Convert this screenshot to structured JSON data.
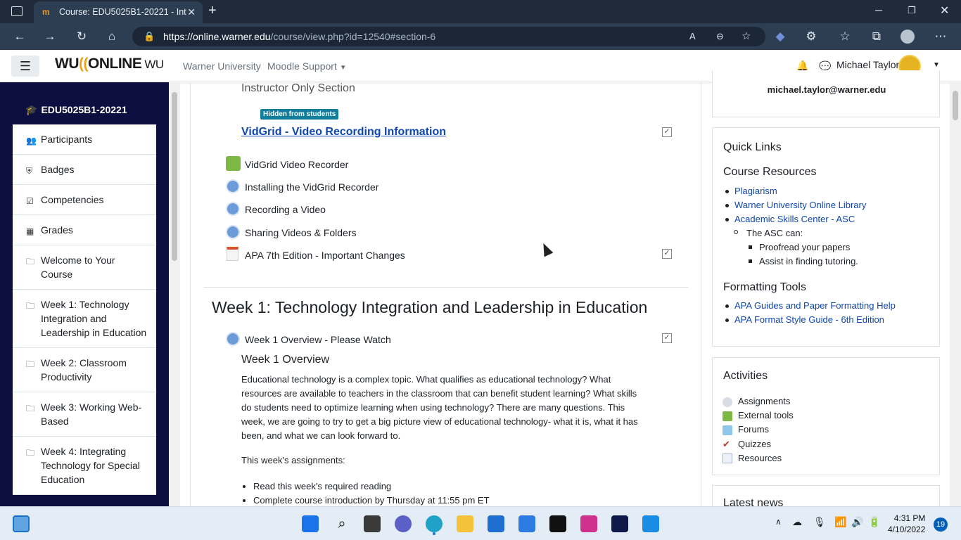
{
  "browser": {
    "tab_title": "Course: EDU5025B1-20221 - Int",
    "tab_favicon": "moodle-icon",
    "url_host": "https://online.warner.edu",
    "url_path": "/course/view.php?id=12540#section-6"
  },
  "topnav": {
    "logo_text": "WU",
    "logo_arc": "((",
    "logo_online": "ONLINE",
    "logo_suffix": "WU",
    "link1": "Warner University",
    "link2": "Moodle Support",
    "username": "Michael Taylor"
  },
  "drawer": {
    "course_code": "EDU5025B1-20221",
    "items": [
      {
        "label": "Participants",
        "icon": "users-icon"
      },
      {
        "label": "Badges",
        "icon": "shield-icon"
      },
      {
        "label": "Competencies",
        "icon": "checkbox-icon"
      },
      {
        "label": "Grades",
        "icon": "table-icon"
      },
      {
        "label": "Welcome to Your Course",
        "icon": "folder-icon"
      },
      {
        "label": "Week 1: Technology Integration and Leadership in Education",
        "icon": "folder-icon"
      },
      {
        "label": "Week 2: Classroom Productivity",
        "icon": "folder-icon"
      },
      {
        "label": "Week 3: Working Web-Based",
        "icon": "folder-icon"
      },
      {
        "label": "Week 4: Integrating Technology for Special Education",
        "icon": "folder-icon"
      }
    ]
  },
  "main": {
    "section_title": "Instructor Only Section",
    "hidden_badge": "Hidden from students",
    "vidgrid_link": "VidGrid - Video Recording Information",
    "activities": [
      {
        "label": "VidGrid Video Recorder",
        "icon": "puzzle-icon"
      },
      {
        "label": "Installing the VidGrid Recorder",
        "icon": "url-icon"
      },
      {
        "label": "Recording a Video",
        "icon": "url-icon"
      },
      {
        "label": "Sharing Videos & Folders",
        "icon": "url-icon"
      },
      {
        "label": "APA 7th Edition - Important Changes",
        "icon": "powerpoint-icon"
      }
    ],
    "week1_title": "Week 1: Technology Integration and Leadership in Education",
    "week1_activity": "Week 1 Overview - Please Watch",
    "week1_overview_heading": "Week 1 Overview",
    "week1_paragraph": "Educational technology is a complex topic. What qualifies as educational technology? What resources are available to teachers in the classroom that can benefit student learning? What skills do students need to optimize learning when using technology? There are many questions. This week, we are going to try to get a big picture view of educational technology- what it is, what it has been, and what we can look forward to.",
    "week1_assignments_label": "This week's assignments:",
    "week1_assignments": [
      "Read this week's required reading",
      "Complete course introduction by Thursday at 11:55 pm ET"
    ]
  },
  "right": {
    "email": "michael.taylor@warner.edu",
    "quick_links_title": "Quick Links",
    "course_resources_title": "Course Resources",
    "resources": [
      "Plagiarism",
      "Warner University Online Library",
      "Academic Skills Center - ASC"
    ],
    "asc_intro": "The ASC can:",
    "asc_items": [
      "Proofread your papers",
      "Assist in finding tutoring."
    ],
    "formatting_title": "Formatting Tools",
    "formatting_links": [
      "APA Guides and Paper Formatting Help",
      "APA Format Style Guide - 6th Edition"
    ],
    "activities_title": "Activities",
    "activities": [
      "Assignments",
      "External tools",
      "Forums",
      "Quizzes",
      "Resources"
    ],
    "latest_news": "Latest news"
  },
  "taskbar": {
    "time": "4:31 PM",
    "date": "4/10/2022",
    "notifications": "19"
  }
}
